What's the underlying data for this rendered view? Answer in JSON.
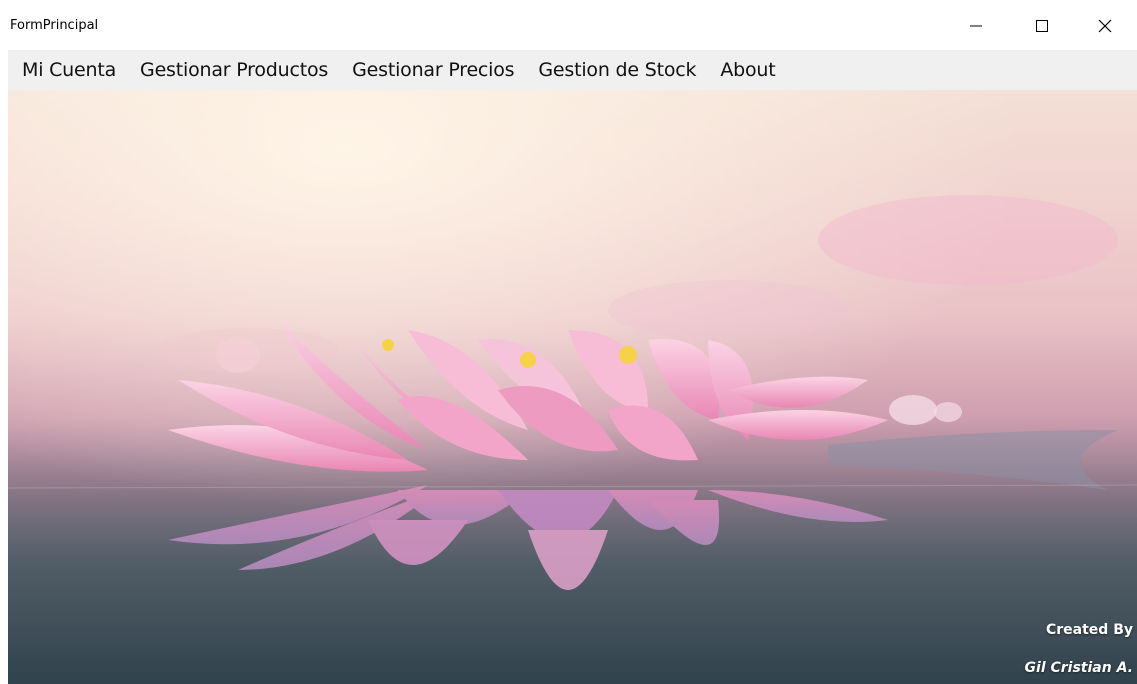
{
  "window": {
    "title": "FormPrincipal"
  },
  "menu": {
    "items": [
      {
        "label": "Mi Cuenta"
      },
      {
        "label": "Gestionar Productos"
      },
      {
        "label": "Gestionar Precios"
      },
      {
        "label": "Gestion de Stock"
      },
      {
        "label": "About"
      }
    ]
  },
  "credits": {
    "line1": "Created By",
    "line2": "Gil Cristian A."
  },
  "icons": {
    "minimize": "minimize-icon",
    "maximize": "maximize-icon",
    "close": "close-icon"
  },
  "colors": {
    "menubar_bg": "#f0f0f0",
    "petal": "#f2a5c8",
    "water": "#33454f"
  }
}
